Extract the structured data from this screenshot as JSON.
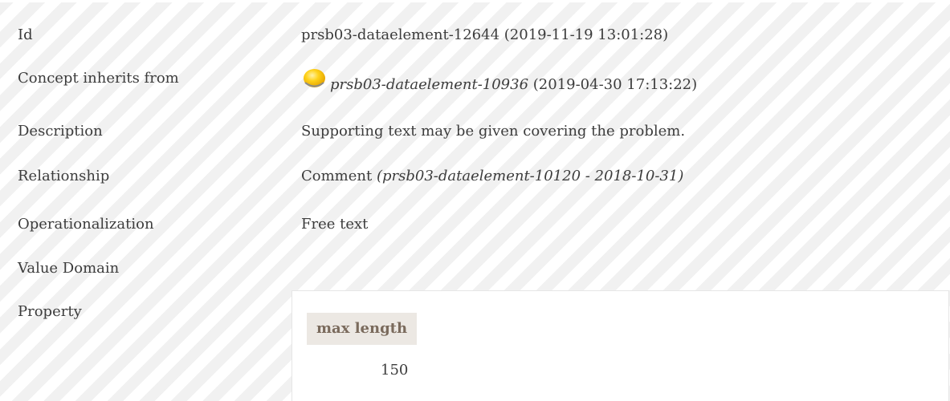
{
  "rows": {
    "id": {
      "label": "Id",
      "value": "prsb03-dataelement-12644 (2019-11-19 13:01:28)"
    },
    "inherits": {
      "label": "Concept inherits from",
      "ref": "prsb03-dataelement-10936",
      "date": " (2019-04-30 17:13:22)"
    },
    "description": {
      "label": "Description",
      "value": "Supporting text may be given covering the problem."
    },
    "relationship": {
      "label": "Relationship",
      "value": "Comment ",
      "ref": "(prsb03-dataelement-10120 - 2018-10-31)"
    },
    "operationalization": {
      "label": "Operationalization",
      "value": "Free text"
    },
    "value_domain": {
      "label": "Value Domain"
    },
    "property": {
      "label": "Property",
      "header": "max length",
      "value": "150"
    }
  },
  "icons": {
    "status": "status-dot-icon"
  },
  "colors": {
    "status_dot": "#f5c200",
    "header_bg": "#ece8e3",
    "header_text": "#7a6a5c"
  }
}
